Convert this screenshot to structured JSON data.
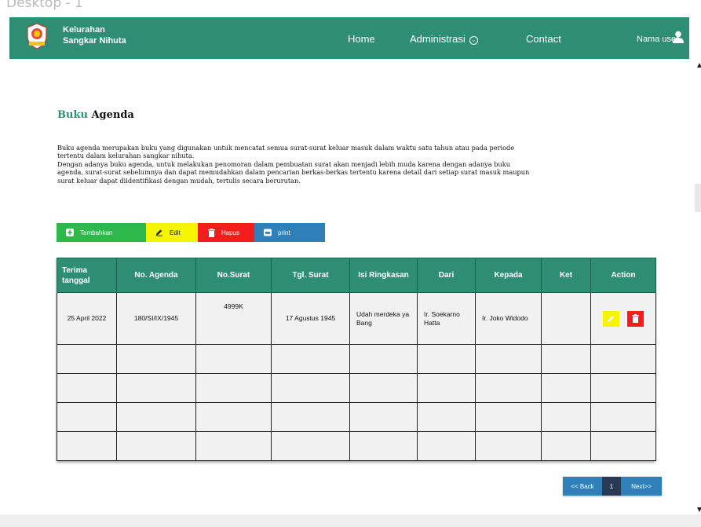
{
  "frame": {
    "label": "Desktop - 1"
  },
  "header": {
    "brand_line1": "Kelurahan",
    "brand_line2": "Sangkar Nihuta",
    "nav": {
      "home": "Home",
      "administrasi": "Administrasi",
      "contact": "Contact"
    },
    "user_name": "Nama user",
    "color": "#2e8e74"
  },
  "page": {
    "title_accent": "Buku",
    "title_rest": "Agenda",
    "description_lines": [
      "Buku agenda merupakan buku yang digunakan untuk mencatat semua surat-surat keluar masuk dalam waktu satu tahun atau pada periode",
      "tertentu dalam kelurahan sangkar nihuta.",
      "Dengan adanya buku agenda, untuk melakukan penomoran dalam pembuatan surat akan menjadi lebih muda karena dengan adanya buku",
      "agenda, surat-surat sebelumnya dan dapat memudahkan dalam pencarian berkas-berkas tertentu karena detail dari setiap surat masuk maupun",
      "surat keluar dapat diidentifikasi dengan mudah, tertulis secara berurutan."
    ]
  },
  "toolbar": {
    "add_label": "Tambahkan",
    "edit_label": "Edit",
    "delete_label": "Hapus",
    "print_label": "print"
  },
  "table": {
    "columns": [
      {
        "label": "Terima tanggal"
      },
      {
        "label": "No. Agenda"
      },
      {
        "label": "No.Surat"
      },
      {
        "label": "Tgl. Surat"
      },
      {
        "label": "Isi Ringkasan"
      },
      {
        "label": "Dari"
      },
      {
        "label": "Kepada"
      },
      {
        "label": "Ket"
      },
      {
        "label": "Action"
      }
    ],
    "rows": [
      {
        "terima_tanggal": "25 April 2022",
        "no_agenda": "180/SI/IX/1945",
        "no_surat": "4999K",
        "tgl_surat": "17 Agustus 1945",
        "isi_ringkasan": "Udah merdeka ya Bang",
        "dari": "Ir. Soekarno Hatta",
        "kepada": "Ir. Joko Widodo",
        "ket": ""
      }
    ],
    "empty_rows": 4
  },
  "pagination": {
    "back": "<< Back",
    "page": "1",
    "next": "Next>>"
  },
  "colors": {
    "primary": "#2e8e74",
    "add": "#2eb84b",
    "edit": "#f5f500",
    "delete": "#f51c1c",
    "print": "#2f80b8",
    "pager_active": "#2a3a55"
  }
}
